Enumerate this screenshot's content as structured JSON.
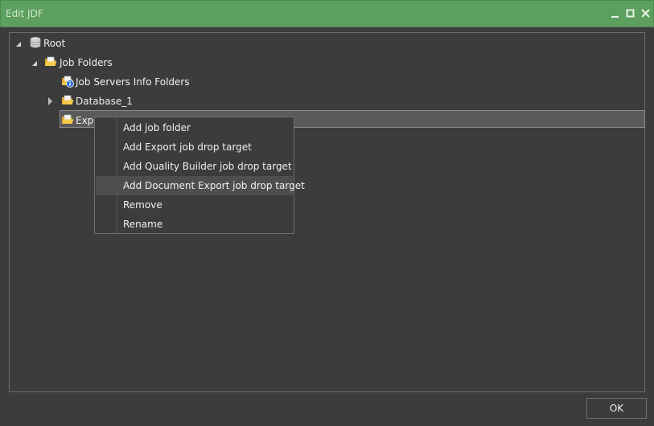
{
  "window": {
    "title": "Edit JDF",
    "controls": {
      "minimize_icon": "minimize-icon",
      "maximize_icon": "maximize-icon",
      "close_icon": "close-icon"
    }
  },
  "tree": {
    "root": {
      "label": "Root",
      "icon": "database-icon",
      "expanded": true
    },
    "job_folders": {
      "label": "Job Folders",
      "icon": "folder-open-icon",
      "expanded": true
    },
    "children": [
      {
        "label": "Job Servers Info Folders",
        "icon": "info-folder-icon"
      },
      {
        "label": "Database_1",
        "icon": "folder-open-icon",
        "expanded": false
      },
      {
        "label": "Expo",
        "icon": "folder-open-icon",
        "selected": true
      }
    ]
  },
  "context_menu": {
    "items": [
      {
        "label": "Add job folder"
      },
      {
        "label": "Add Export job drop target"
      },
      {
        "label": "Add Quality Builder job drop target"
      },
      {
        "label": "Add Document Export job drop target",
        "highlighted": true
      },
      {
        "label": "Remove"
      },
      {
        "label": "Rename"
      }
    ]
  },
  "footer": {
    "ok_label": "OK"
  },
  "colors": {
    "title_bar": "#5c9f5e",
    "background": "#3c3c3c",
    "selection": "#5a5a5a"
  }
}
